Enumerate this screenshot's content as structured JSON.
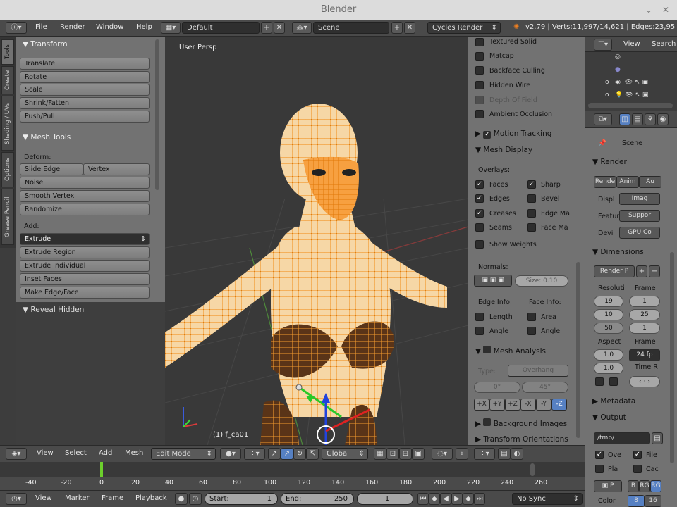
{
  "window": {
    "title": "Blender"
  },
  "info": {
    "menus": [
      "File",
      "Render",
      "Window",
      "Help"
    ],
    "layout": "Default",
    "scene": "Scene",
    "engine": "Cycles Render",
    "stats": "v2.79 | Verts:11,997/14,621 | Edges:23,95"
  },
  "vtabs": [
    "Tools",
    "Create",
    "Shading / UVs",
    "Options",
    "Grease Pencil"
  ],
  "toolshelf": {
    "transform_header": "Transform",
    "transform_buttons": [
      "Translate",
      "Rotate",
      "Scale",
      "Shrink/Fatten",
      "Push/Pull"
    ],
    "meshtools_header": "Mesh Tools",
    "deform_label": "Deform:",
    "slide_edge": "Slide Edge",
    "vertex": "Vertex",
    "deform_buttons": [
      "Noise",
      "Smooth Vertex",
      "Randomize"
    ],
    "add_label": "Add:",
    "extrude": "Extrude",
    "add_buttons": [
      "Extrude Region",
      "Extrude Individual",
      "Inset Faces",
      "Make Edge/Face"
    ],
    "reveal_header": "Reveal Hidden"
  },
  "viewport": {
    "view_name": "User Persp",
    "object_label": "(1) f_ca01"
  },
  "npanel": {
    "shading_items": [
      {
        "label": "Textured Solid",
        "checked": false
      },
      {
        "label": "Matcap",
        "checked": false
      },
      {
        "label": "Backface Culling",
        "checked": false
      },
      {
        "label": "Hidden Wire",
        "checked": false
      },
      {
        "label": "Depth Of Field",
        "checked": false
      },
      {
        "label": "Ambient Occlusion",
        "checked": false
      }
    ],
    "motion_tracking": "Motion Tracking",
    "mesh_display": "Mesh Display",
    "overlays_label": "Overlays:",
    "overlays_left": [
      {
        "label": "Faces",
        "checked": true
      },
      {
        "label": "Edges",
        "checked": true
      },
      {
        "label": "Creases",
        "checked": true
      },
      {
        "label": "Seams",
        "checked": false
      }
    ],
    "overlays_right": [
      {
        "label": "Sharp",
        "checked": true
      },
      {
        "label": "Bevel",
        "checked": false
      },
      {
        "label": "Edge Ma",
        "checked": false
      },
      {
        "label": "Face Ma",
        "checked": false
      }
    ],
    "show_weights": "Show Weights",
    "normals_label": "Normals:",
    "size_label": "Size:",
    "size_value": "0.10",
    "edge_info": "Edge Info:",
    "face_info": "Face Info:",
    "length": "Length",
    "angle": "Angle",
    "area": "Area",
    "angle2": "Angle",
    "mesh_analysis": "Mesh Analysis",
    "type_label": "Type:",
    "type_value": "Overhang",
    "min_angle": "0°",
    "max_angle": "45°",
    "axes": [
      "+X",
      "+Y",
      "+Z",
      "-X",
      "-Y",
      "-Z"
    ],
    "background_images": "Background Images",
    "transform_orientations": "Transform Orientations"
  },
  "outliner": {
    "view": "View",
    "search": "Search"
  },
  "props": {
    "scene": "Scene",
    "render_header": "Render",
    "render_btns": [
      "Rende",
      "Anim",
      "Au"
    ],
    "displ_label": "Displ",
    "displ_value": "Imag",
    "featur_label": "Featur",
    "featur_value": "Suppor",
    "devi_label": "Devi",
    "devi_value": "GPU Co",
    "dimensions_header": "Dimensions",
    "preset": "Render P",
    "resolution_label": "Resoluti",
    "frame_label": "Frame",
    "res_x": "19",
    "res_y": "10",
    "res_pct": "50",
    "frame_start": "1",
    "frame_end": "25",
    "frame_step": "1",
    "aspect_label": "Aspect",
    "frame_rate_label": "Frame",
    "aspect_x": "1.0",
    "aspect_y": "1.0",
    "fps": "24 fp",
    "time_label": "Time R",
    "metadata_header": "Metadata",
    "output_header": "Output",
    "output_path": "/tmp/",
    "ove": "Ove",
    "file": "File",
    "pla": "Pla",
    "cac": "Cac",
    "format": "P",
    "bw": "B",
    "rgb": "RG",
    "rgba": "RG",
    "color_label": "Color",
    "color_depth_8": "8",
    "color_depth_16": "16"
  },
  "vheader": {
    "menus": [
      "View",
      "Select",
      "Add",
      "Mesh"
    ],
    "mode": "Edit Mode",
    "orientation": "Global"
  },
  "timeline": {
    "ticks": [
      "-40",
      "-20",
      "0",
      "20",
      "40",
      "60",
      "80",
      "100",
      "120",
      "140",
      "160",
      "180",
      "200",
      "220",
      "240",
      "260"
    ],
    "menus": [
      "View",
      "Marker",
      "Frame",
      "Playback"
    ],
    "start_label": "Start:",
    "start_value": "1",
    "end_label": "End:",
    "end_value": "250",
    "current_frame": "1",
    "sync": "No Sync"
  },
  "colors": {
    "accent": "#5680c2",
    "mesh_orange": "#f29a2e",
    "selection_orange": "#ff8c00",
    "panel_gray": "#727272",
    "viewport_bg": "#393939"
  }
}
